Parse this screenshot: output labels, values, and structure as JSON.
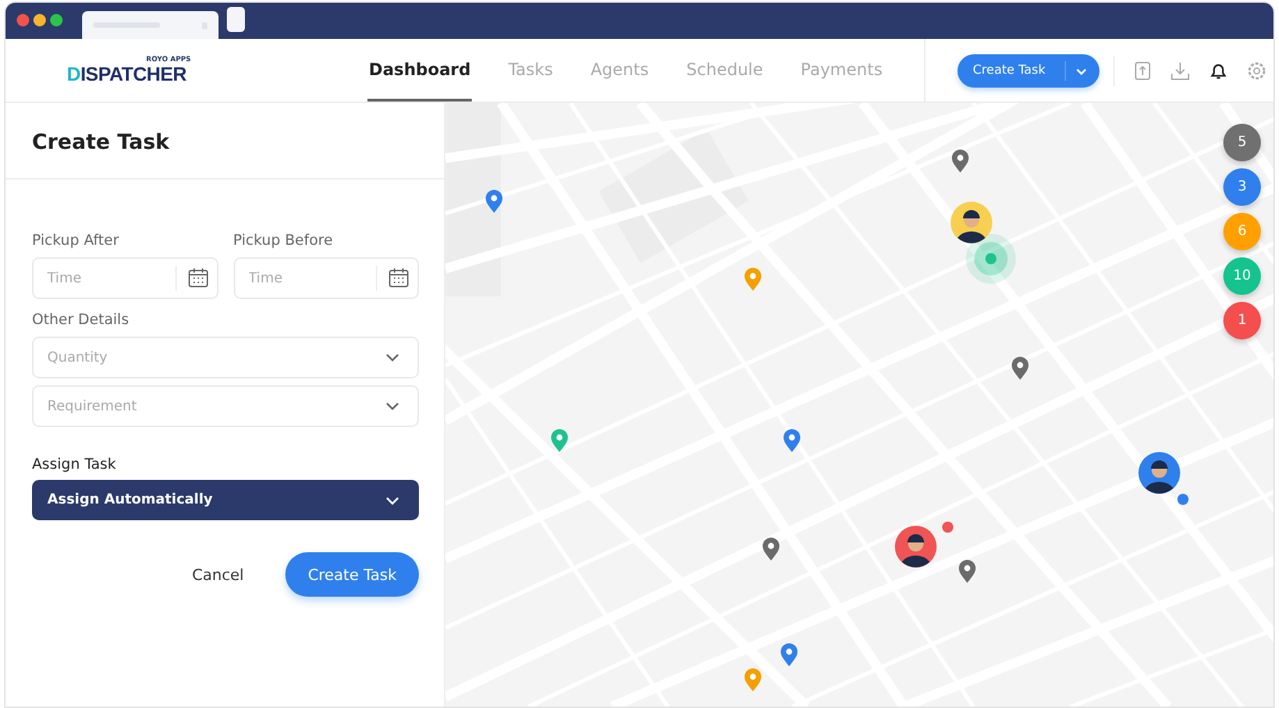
{
  "browser": {
    "tabs": [
      {
        "selected": true
      },
      {
        "selected": false
      }
    ]
  },
  "header": {
    "logo_caption": "ROYO APPS",
    "logo": "DISPATCHER",
    "nav": [
      {
        "label": "Dashboard",
        "selected": true
      },
      {
        "label": "Tasks",
        "selected": false
      },
      {
        "label": "Agents",
        "selected": false
      },
      {
        "label": "Schedule",
        "selected": false
      },
      {
        "label": "Payments",
        "selected": false
      }
    ],
    "create_button": "Create Task"
  },
  "panel": {
    "title": "Create Task",
    "pickup_after": {
      "label": "Pickup After",
      "placeholder": "Time"
    },
    "pickup_before": {
      "label": "Pickup Before",
      "placeholder": "Time"
    },
    "other_details": {
      "label": "Other Details",
      "selects": [
        "Quantity",
        "Requirement"
      ]
    },
    "assign": {
      "label": "Assign Task",
      "value": "Assign Automatically"
    },
    "cancel": "Cancel",
    "submit": "Create Task"
  },
  "map": {
    "pins": [
      {
        "color": "#2f80ed"
      },
      {
        "color": "#6b6b6b"
      },
      {
        "color": "#f5a000"
      },
      {
        "color": "#6b6b6b"
      },
      {
        "color": "#1fc28f"
      },
      {
        "color": "#2f80ed"
      },
      {
        "color": "#6b6b6b"
      },
      {
        "color": "#6b6b6b"
      },
      {
        "color": "#2f80ed"
      },
      {
        "color": "#f5a000"
      }
    ],
    "agents": [
      {
        "color": "#f8cf4f",
        "dot": false
      },
      {
        "color": "#2f80ed",
        "dot": true
      },
      {
        "color": "#f05454",
        "dot": true
      }
    ],
    "clusters": [
      {
        "count": "5",
        "color": "#707070"
      },
      {
        "count": "3",
        "color": "#2f80ed"
      },
      {
        "count": "6",
        "color": "#ffa000"
      },
      {
        "count": "10",
        "color": "#14c38e"
      },
      {
        "count": "1",
        "color": "#f54e4e"
      }
    ]
  }
}
